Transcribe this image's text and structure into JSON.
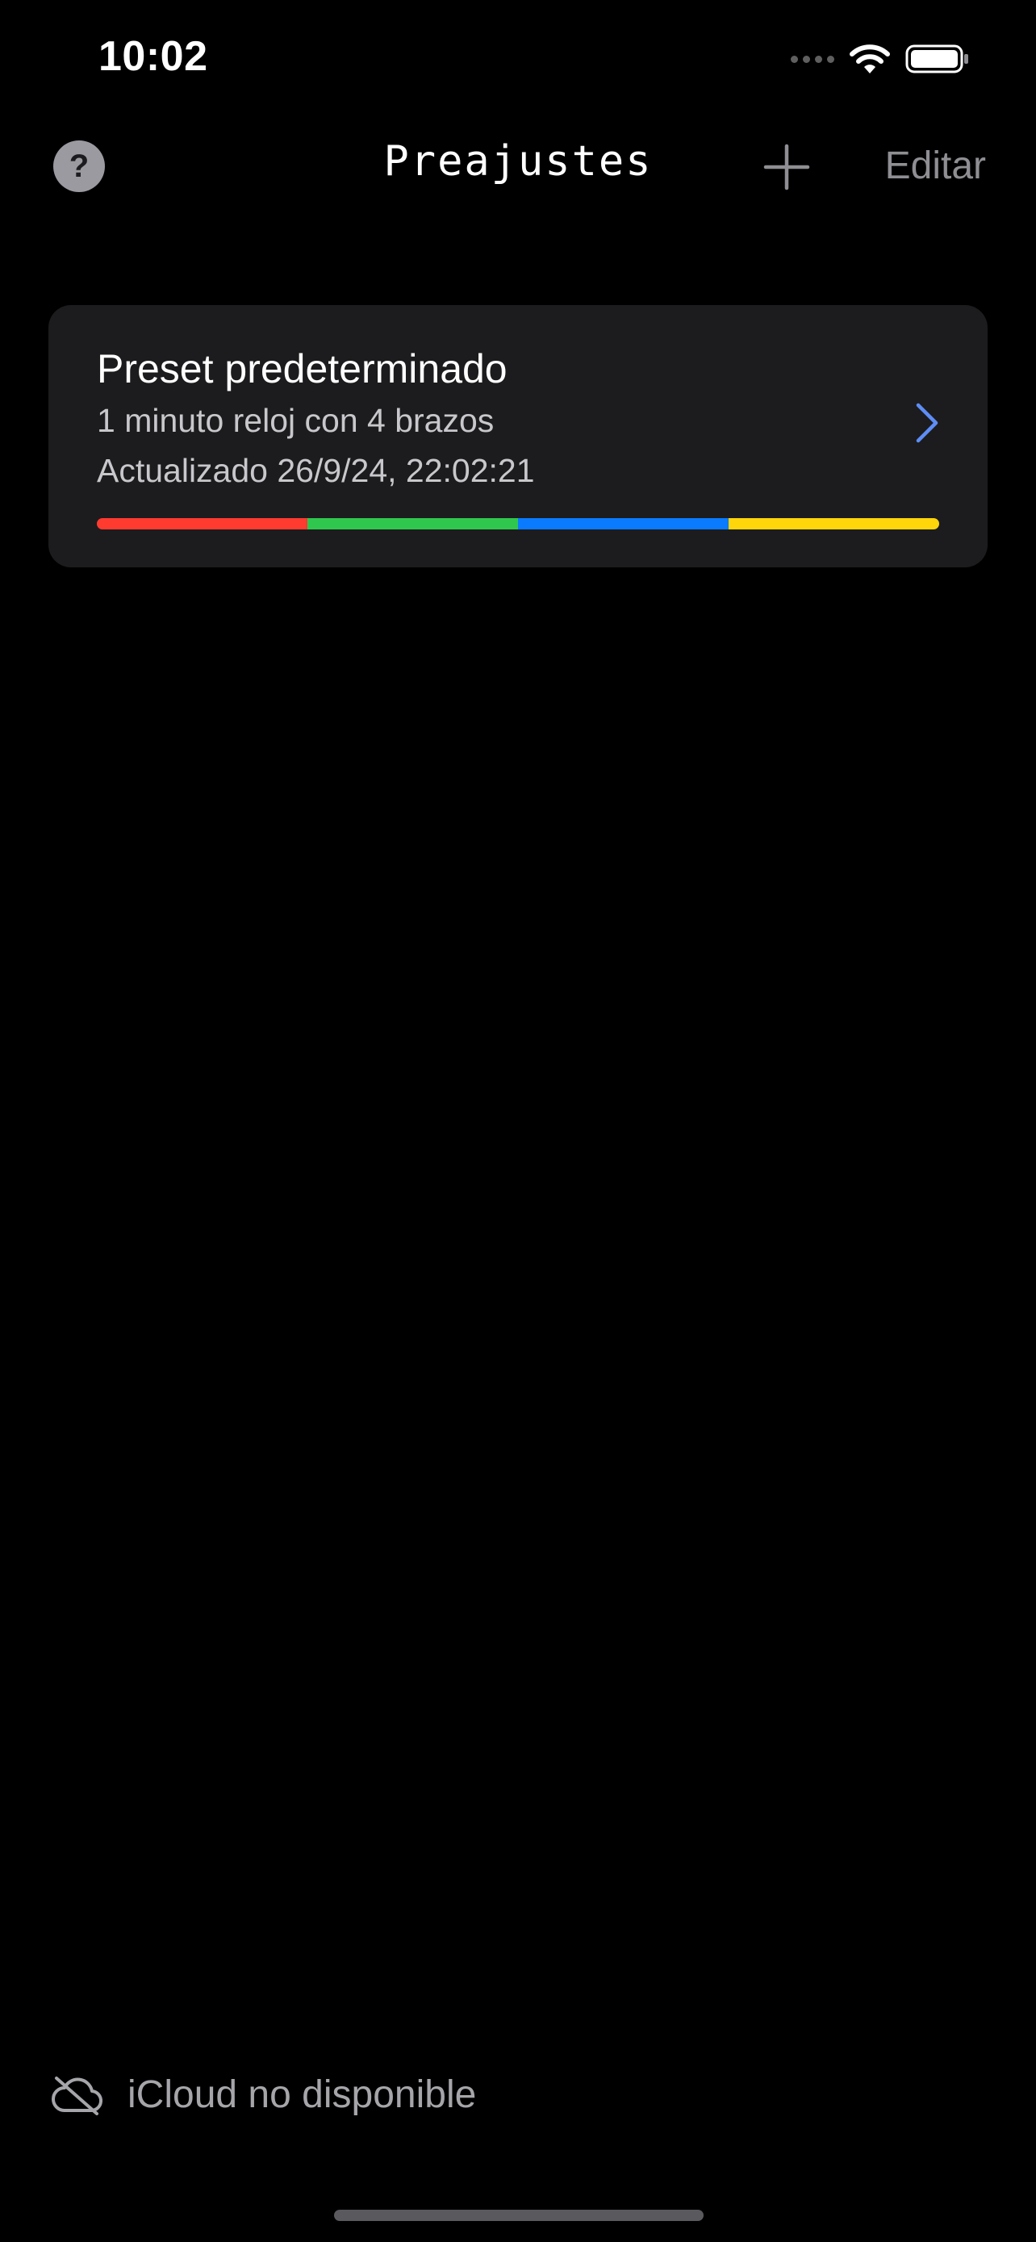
{
  "status_bar": {
    "time": "10:02",
    "icons": [
      "cellular-signal-icon",
      "wifi-icon",
      "battery-icon"
    ]
  },
  "nav": {
    "help_label": "?",
    "title": "Preajustes",
    "add_icon": "plus-icon",
    "edit_label": "Editar"
  },
  "presets": [
    {
      "name": "Preset predeterminado",
      "description": "1 minuto reloj con 4 brazos",
      "updated": "Actualizado 26/9/24, 22:02:21",
      "colors": [
        "#ff3b30",
        "#30c74f",
        "#0a7aff",
        "#ffd60a"
      ]
    }
  ],
  "footer": {
    "icloud_icon": "cloud-off-icon",
    "icloud_label": "iCloud no disponible"
  },
  "theme": {
    "background": "#000000",
    "card": "#1c1c1e",
    "accent": "#5e8df5",
    "secondary_text": "#8e8e93"
  }
}
